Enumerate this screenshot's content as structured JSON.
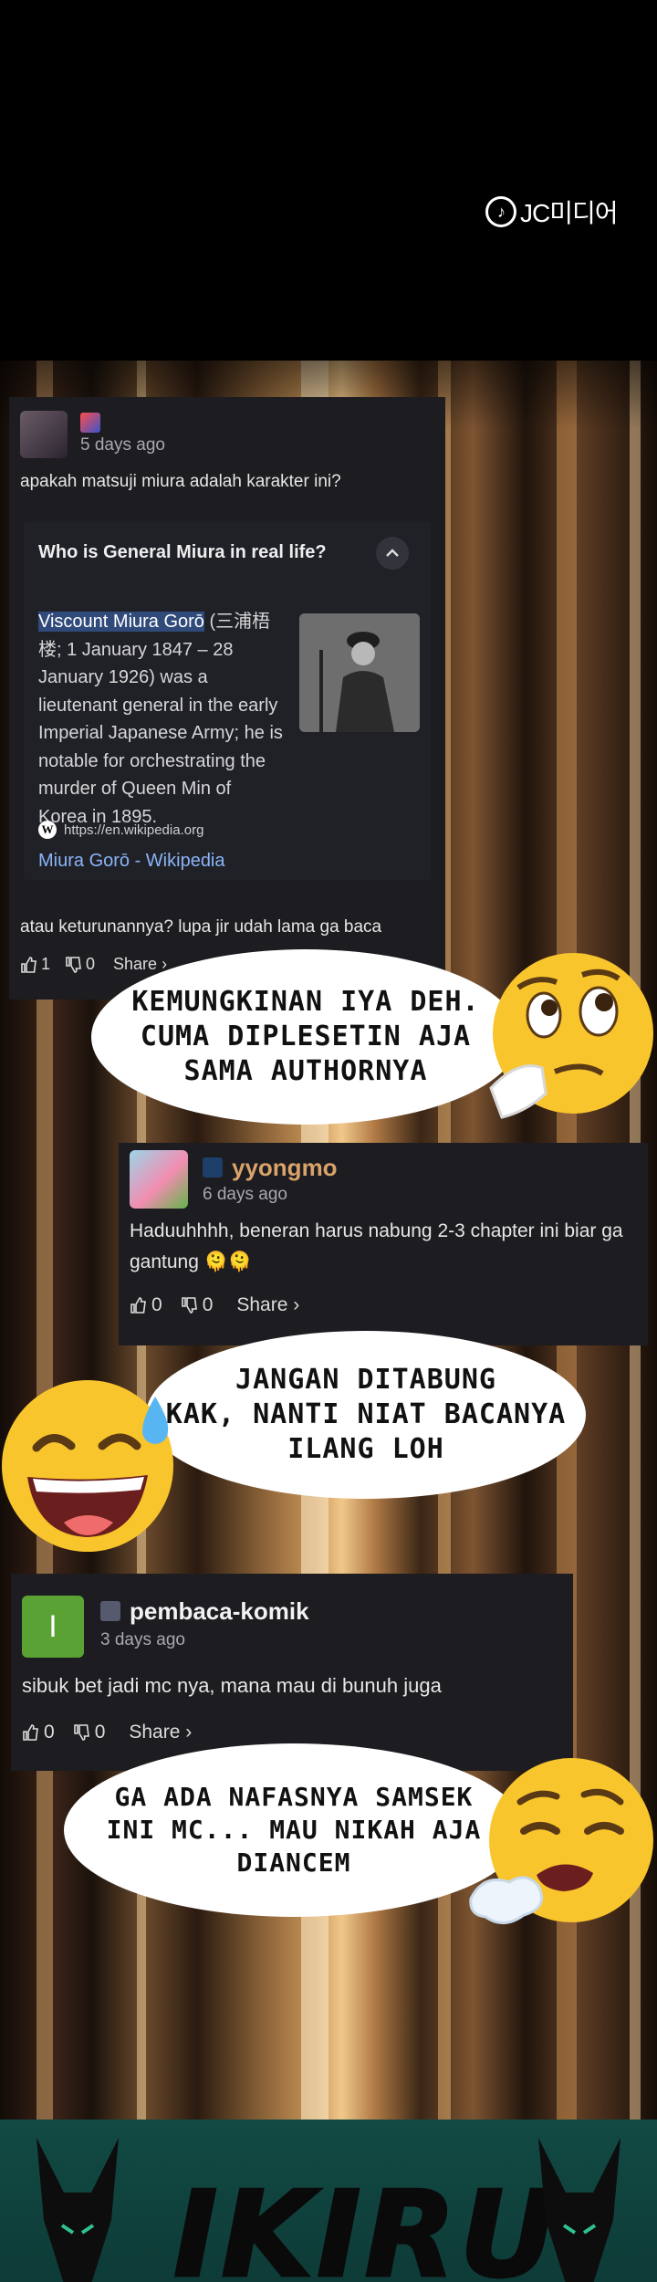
{
  "watermark": {
    "text": "JC미디어"
  },
  "comments": [
    {
      "username": "",
      "time": "5 days ago",
      "text_line1": "apakah matsuji miura adalah karakter ini?",
      "ai_overview": {
        "question": "Who is General Miura in real life?",
        "highlight": "Viscount Miura Gorō",
        "body": " (三浦梧楼; 1 January 1847 – 28 January 1926) was a lieutenant general in the early Imperial Japanese Army; he is notable for orchestrating the murder of Queen Min of Korea in 1895.",
        "source_url": "https://en.wikipedia.org",
        "source_title": "Miura Gorō - Wikipedia"
      },
      "text_line2": "atau keturunannya? lupa jir udah lama ga baca",
      "likes": "1",
      "dislikes": "0",
      "share": "Share ›"
    },
    {
      "username": "yyongmo",
      "time": "6 days ago",
      "text": "Haduuhhhh, beneran harus nabung 2-3 chapter ini biar ga gantung 🫠🫠",
      "likes": "0",
      "dislikes": "0",
      "share": "Share ›"
    },
    {
      "username": "pembaca-komik",
      "avatar_letter": "I",
      "time": "3 days ago",
      "text": "sibuk bet jadi mc nya, mana mau di bunuh juga",
      "likes": "0",
      "dislikes": "0",
      "share": "Share ›"
    }
  ],
  "bubbles": [
    {
      "text": "KEMUNGKINAN IYA DEH.\nCUMA DIPLESETIN AJA\nSAMA AUTHORNYA"
    },
    {
      "text": "JANGAN DITABUNG\nKAK, NANTI NIAT BACANYA\nILANG LOH"
    },
    {
      "text": "GA ADA NAFASNYA SAMSEK\nINI MC... MAU NIKAH AJA\nDIANCEM"
    }
  ],
  "emojis": [
    "thinking-face-icon",
    "sweat-smile-icon",
    "exhaling-face-icon"
  ],
  "banner": {
    "text": "IKIRU"
  },
  "colors": {
    "card_bg": "#1c1c21",
    "username2": "#d9a36a",
    "link": "#8ab4f8",
    "banner_bg": "#124a44"
  }
}
